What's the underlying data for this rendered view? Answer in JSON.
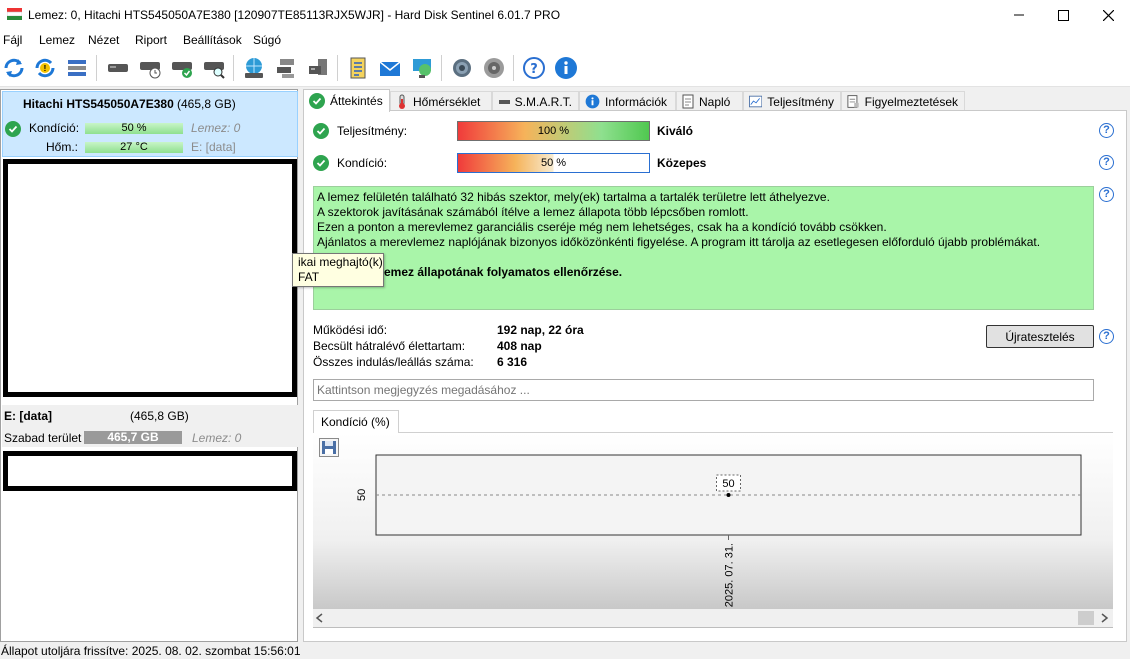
{
  "window": {
    "title": "Lemez: 0, Hitachi HTS545050A7E380 [120907TE85113RJX5WJR]  -  Hard Disk Sentinel 6.01.7 PRO"
  },
  "menu": [
    {
      "label": "Fájl"
    },
    {
      "label": "Lemez"
    },
    {
      "label": "Nézet"
    },
    {
      "label": "Riport"
    },
    {
      "label": "Beállítások"
    },
    {
      "label": "Súgó"
    }
  ],
  "toolbar": {
    "icons": [
      "refresh-icon",
      "refresh-warning-icon",
      "disk-list-icon",
      "disk-icon",
      "disk-clock-icon",
      "disk-check-icon",
      "disk-search-icon",
      "network-disk-icon",
      "server-disk-icon",
      "disk-transfer-icon",
      "report-icon",
      "mail-icon",
      "network-globe-icon",
      "settings-icon",
      "sound-icon",
      "help-icon",
      "info-icon"
    ]
  },
  "disk": {
    "name": "Hitachi HTS545050A7E380",
    "size": "(465,8 GB)",
    "condition_label": "Kondíció:",
    "condition_value": "50 %",
    "condition_level": 50,
    "condition_drive_note": "Lemez: 0",
    "temp_label": "Hőm.:",
    "temp_value": "27 °C",
    "partition_note": "E: [data]"
  },
  "volume": {
    "name": "E: [data]",
    "size": "(465,8 GB)",
    "free_label": "Szabad terület",
    "free_value": "465,7 GB",
    "free_level": 100,
    "drive_note": "Lemez: 0"
  },
  "tooltip": {
    "line1": "ikai meghajtó(k)",
    "line2": "FAT"
  },
  "tabs": [
    {
      "label": "Áttekintés",
      "icon": "check-icon",
      "active": true
    },
    {
      "label": "Hőmérséklet",
      "icon": "thermometer-icon"
    },
    {
      "label": "S.M.A.R.T.",
      "icon": "dash-icon"
    },
    {
      "label": "Információk",
      "icon": "info-icon"
    },
    {
      "label": "Napló",
      "icon": "document-icon"
    },
    {
      "label": "Teljesítmény",
      "icon": "chart-icon"
    },
    {
      "label": "Figyelmeztetések",
      "icon": "alert-doc-icon"
    }
  ],
  "overview": {
    "performance_label": "Teljesítmény:",
    "performance_value": "100 %",
    "performance_level": 100,
    "performance_rating": "Kiváló",
    "condition_label": "Kondíció:",
    "condition_value": "50 %",
    "condition_level": 50,
    "condition_rating": "Közepes",
    "message_lines": [
      "A lemez felületén található 32 hibás szektor, mely(ek) tartalma a tartalék területre lett áthelyezve.",
      "A szektorok javításának számából ítélve a lemez állapota több lépcsőben romlott.",
      "Ezen a ponton a merevlemez garanciális cseréje még nem lehetséges, csak ha a kondíció tovább csökken.",
      "Ajánlatos a merevlemez naplójának bizonyos időközönkénti figyelése. A program itt tárolja az esetlegesen előforduló újabb problémákat."
    ],
    "message_bold": "emez állapotának folyamatos ellenőrzése.",
    "uptime_label": "Működési idő:",
    "uptime_value": "192 nap, 22 óra",
    "remaining_label": "Becsült hátralévő élettartam:",
    "remaining_value": "408 nap",
    "startstop_label": "Összes indulás/leállás száma:",
    "startstop_value": "6 316",
    "retest_button": "Újratesztelés",
    "note_placeholder": "Kattintson megjegyzés megadásához ...",
    "chart_tab": "Kondíció  (%)"
  },
  "chart_data": {
    "type": "line",
    "x": [
      "2025. 07. 31."
    ],
    "series": [
      {
        "values": [
          50
        ]
      }
    ],
    "y_tick_label": "50",
    "data_label": "50",
    "ylabel": "",
    "xlabel": ""
  },
  "status": {
    "text": "Állapot utoljára frissítve: 2025. 08. 02. szombat 15:56:01"
  },
  "colors": {
    "selected_card": "#cce8ff",
    "message_bg": "#a9f5a9",
    "ok_green": "#2ea44f",
    "help_blue": "#2a6fd1"
  }
}
